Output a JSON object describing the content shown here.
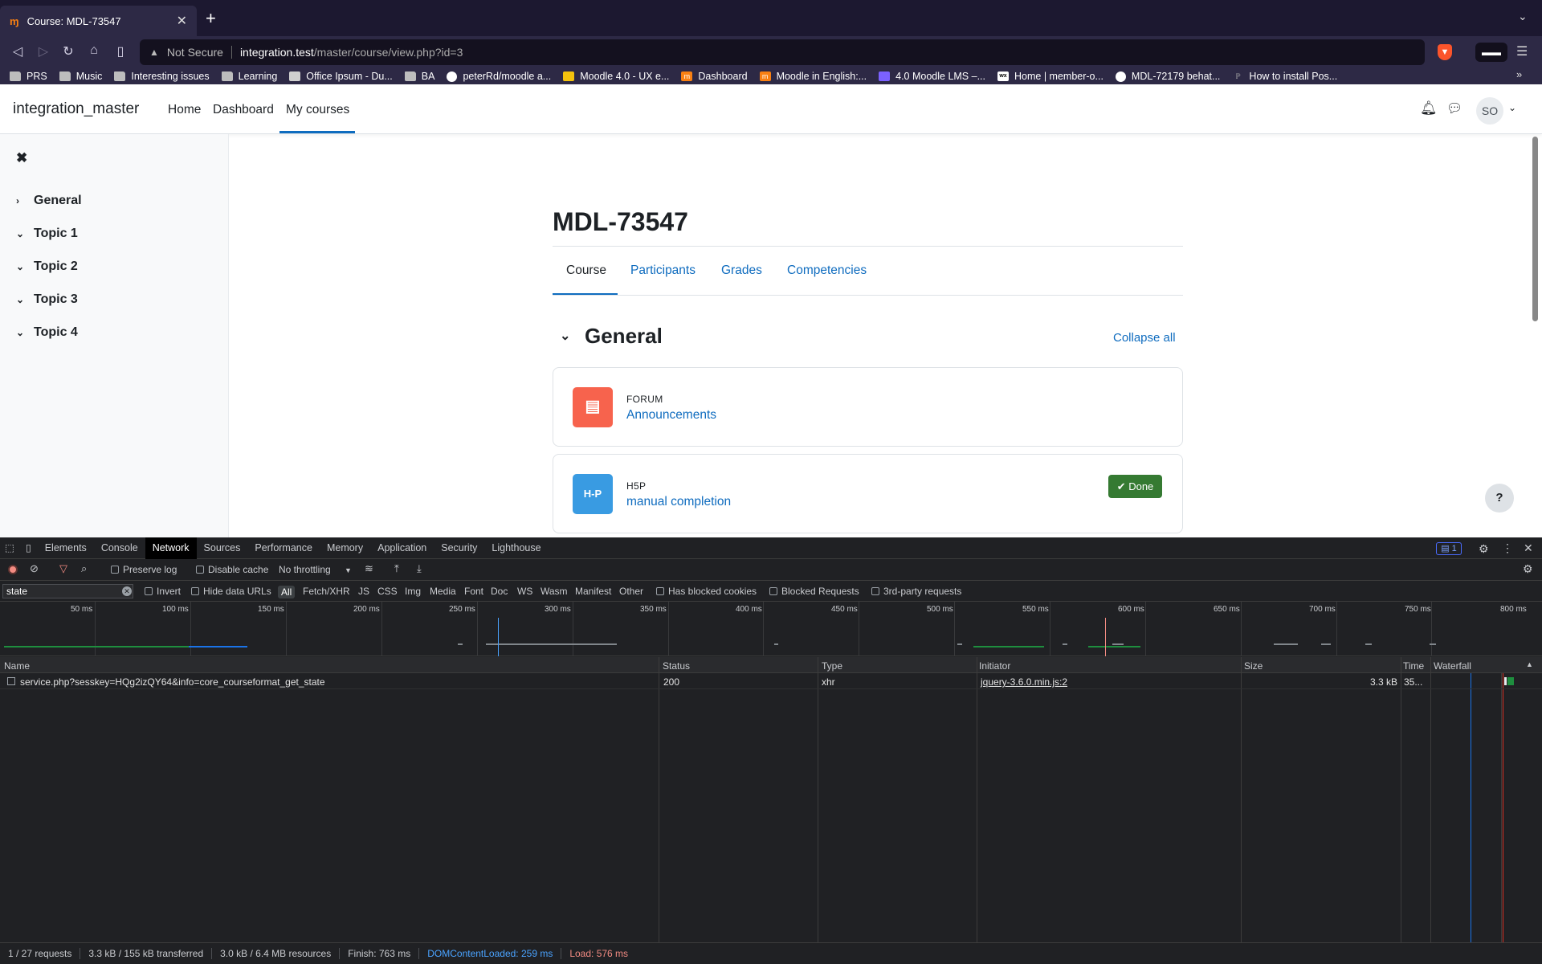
{
  "browser": {
    "tab_title": "Course: MDL-73547",
    "tab_favicon": "moodle-favicon",
    "new_tab": "+",
    "security": "Not Secure",
    "url_host": "integration.test",
    "url_path": "/master/course/view.php?id=3",
    "bookmarks": [
      {
        "label": "PRS",
        "icon": "folder-icon"
      },
      {
        "label": "Music",
        "icon": "folder-icon"
      },
      {
        "label": "Interesting issues",
        "icon": "folder-icon"
      },
      {
        "label": "Learning",
        "icon": "folder-icon"
      },
      {
        "label": "Office Ipsum - Du...",
        "icon": "page-icon"
      },
      {
        "label": "BA",
        "icon": "folder-icon"
      },
      {
        "label": "peterRd/moodle a...",
        "icon": "github-icon"
      },
      {
        "label": "Moodle 4.0 - UX e...",
        "icon": "doc-icon"
      },
      {
        "label": "Dashboard",
        "icon": "moodle-icon"
      },
      {
        "label": "Moodle in English:...",
        "icon": "moodle-icon"
      },
      {
        "label": "4.0 Moodle LMS –...",
        "icon": "figma-icon"
      },
      {
        "label": "Home | member-o...",
        "icon": "wix-icon"
      },
      {
        "label": "MDL-72179 behat...",
        "icon": "github-icon"
      },
      {
        "label": "How to install Pos...",
        "icon": "page-icon"
      }
    ]
  },
  "moodle": {
    "site_name": "integration_master",
    "nav": [
      "Home",
      "Dashboard",
      "My courses"
    ],
    "avatar_initials": "SO"
  },
  "drawer": {
    "close": "✖",
    "sections": [
      {
        "label": "General",
        "expanded": false
      },
      {
        "label": "Topic 1",
        "expanded": true
      },
      {
        "label": "Topic 2",
        "expanded": true
      },
      {
        "label": "Topic 3",
        "expanded": true
      },
      {
        "label": "Topic 4",
        "expanded": true
      }
    ]
  },
  "course": {
    "title": "MDL-73547",
    "tabs": [
      "Course",
      "Participants",
      "Grades",
      "Competencies"
    ],
    "section_title": "General",
    "collapse_all": "Collapse all",
    "activities": [
      {
        "type": "FORUM",
        "name": "Announcements",
        "icon_color": "#f7634d"
      },
      {
        "type": "H5P",
        "name": "manual completion",
        "icon_color": "#399be2",
        "icon_text": "H-P",
        "completion": "✔ Done"
      }
    ],
    "help": "?"
  },
  "devtools": {
    "tabs": [
      "Elements",
      "Console",
      "Network",
      "Sources",
      "Performance",
      "Memory",
      "Application",
      "Security",
      "Lighthouse"
    ],
    "active_tab": "Network",
    "issues_badge": "1",
    "toolbar": {
      "preserve_log": "Preserve log",
      "disable_cache": "Disable cache",
      "throttling": "No throttling"
    },
    "filter_value": "state",
    "filter_bar": {
      "invert": "Invert",
      "hide_data_urls": "Hide data URLs",
      "types": [
        "All",
        "Fetch/XHR",
        "JS",
        "CSS",
        "Img",
        "Media",
        "Font",
        "Doc",
        "WS",
        "Wasm",
        "Manifest",
        "Other"
      ],
      "has_blocked_cookies": "Has blocked cookies",
      "blocked_requests": "Blocked Requests",
      "third_party": "3rd-party requests"
    },
    "timeline_ticks": [
      "50 ms",
      "100 ms",
      "150 ms",
      "200 ms",
      "250 ms",
      "300 ms",
      "350 ms",
      "400 ms",
      "450 ms",
      "500 ms",
      "550 ms",
      "600 ms",
      "650 ms",
      "700 ms",
      "750 ms",
      "800 ms"
    ],
    "columns": [
      "Name",
      "Status",
      "Type",
      "Initiator",
      "Size",
      "Time",
      "Waterfall"
    ],
    "requests": [
      {
        "name": "service.php?sesskey=HQg2izQY64&info=core_courseformat_get_state",
        "status": "200",
        "type": "xhr",
        "initiator": "jquery-3.6.0.min.js:2",
        "size": "3.3 kB",
        "time": "35..."
      }
    ],
    "status_bar": {
      "requests": "1 / 27 requests",
      "transferred": "3.3 kB / 155 kB transferred",
      "resources": "3.0 kB / 6.4 MB resources",
      "finish": "Finish: 763 ms",
      "dom_content_loaded": "DOMContentLoaded: 259 ms",
      "load": "Load: 576 ms"
    }
  }
}
